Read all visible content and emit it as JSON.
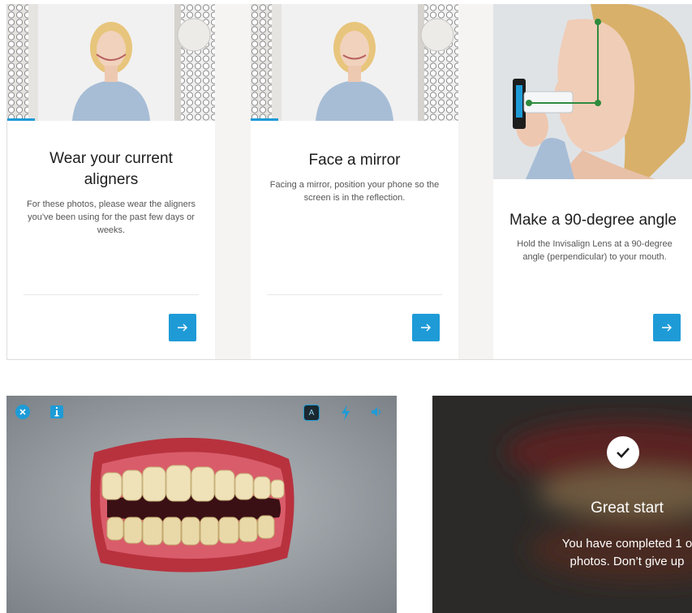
{
  "cards": [
    {
      "title": "Wear your current aligners",
      "body": "For these photos, please wear the aligners you've been using for the past few days or weeks.",
      "next_icon": "arrow-right-icon"
    },
    {
      "title": "Face a mirror",
      "body": "Facing a mirror, position your phone so the screen is in the reflection.",
      "next_icon": "arrow-right-icon"
    },
    {
      "title": "Make a 90-degree angle",
      "body": "Hold the Invisalign Lens at a 90-degree angle (perpendicular) to your mouth.",
      "next_icon": "arrow-right-icon"
    }
  ],
  "camera": {
    "icons": [
      "close-icon",
      "info-icon",
      "auto-mode-icon",
      "flash-icon",
      "sound-icon"
    ],
    "auto_label": "A"
  },
  "success": {
    "icon": "checkmark-icon",
    "title": "Great start",
    "body": "You have completed 1 o\nphotos. Don’t give up"
  },
  "colors": {
    "accent": "#1e9bd7",
    "title_text": "#1d1d1d",
    "body_text": "#555555"
  }
}
